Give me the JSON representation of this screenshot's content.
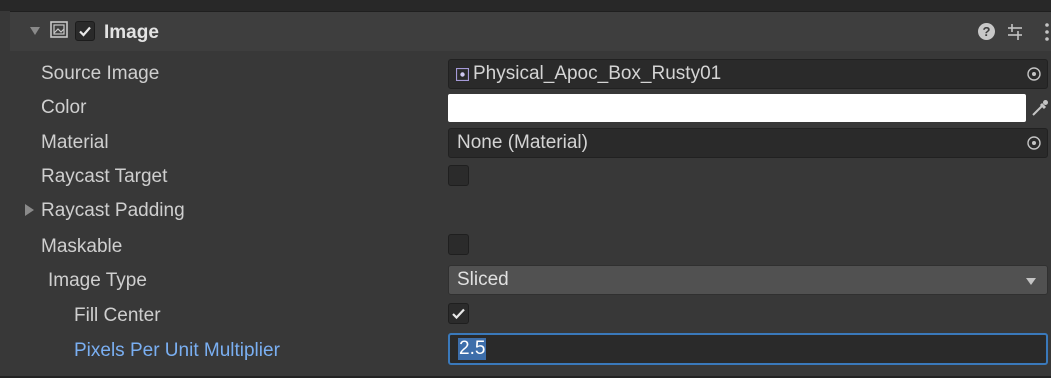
{
  "header": {
    "title": "Image",
    "enabled": true,
    "help_glyph": "?"
  },
  "properties": {
    "source_image": {
      "label": "Source Image",
      "value": "Physical_Apoc_Box_Rusty01",
      "icon": "sprite-icon"
    },
    "color": {
      "label": "Color",
      "value": "#ffffff"
    },
    "material": {
      "label": "Material",
      "value": "None (Material)"
    },
    "raycast_target": {
      "label": "Raycast Target",
      "checked": false
    },
    "raycast_padding": {
      "label": "Raycast Padding",
      "expanded": false
    },
    "maskable": {
      "label": "Maskable",
      "checked": false
    },
    "image_type": {
      "label": "Image Type",
      "value": "Sliced",
      "options_visible": [
        "Sliced"
      ]
    },
    "fill_center": {
      "label": "Fill Center",
      "checked": true
    },
    "ppu_multiplier": {
      "label": "Pixels Per Unit Multiplier",
      "value": "2.5"
    }
  },
  "colors": {
    "focus": "#3a79bb",
    "focus_label": "#7aaff2",
    "panel": "#383838"
  }
}
